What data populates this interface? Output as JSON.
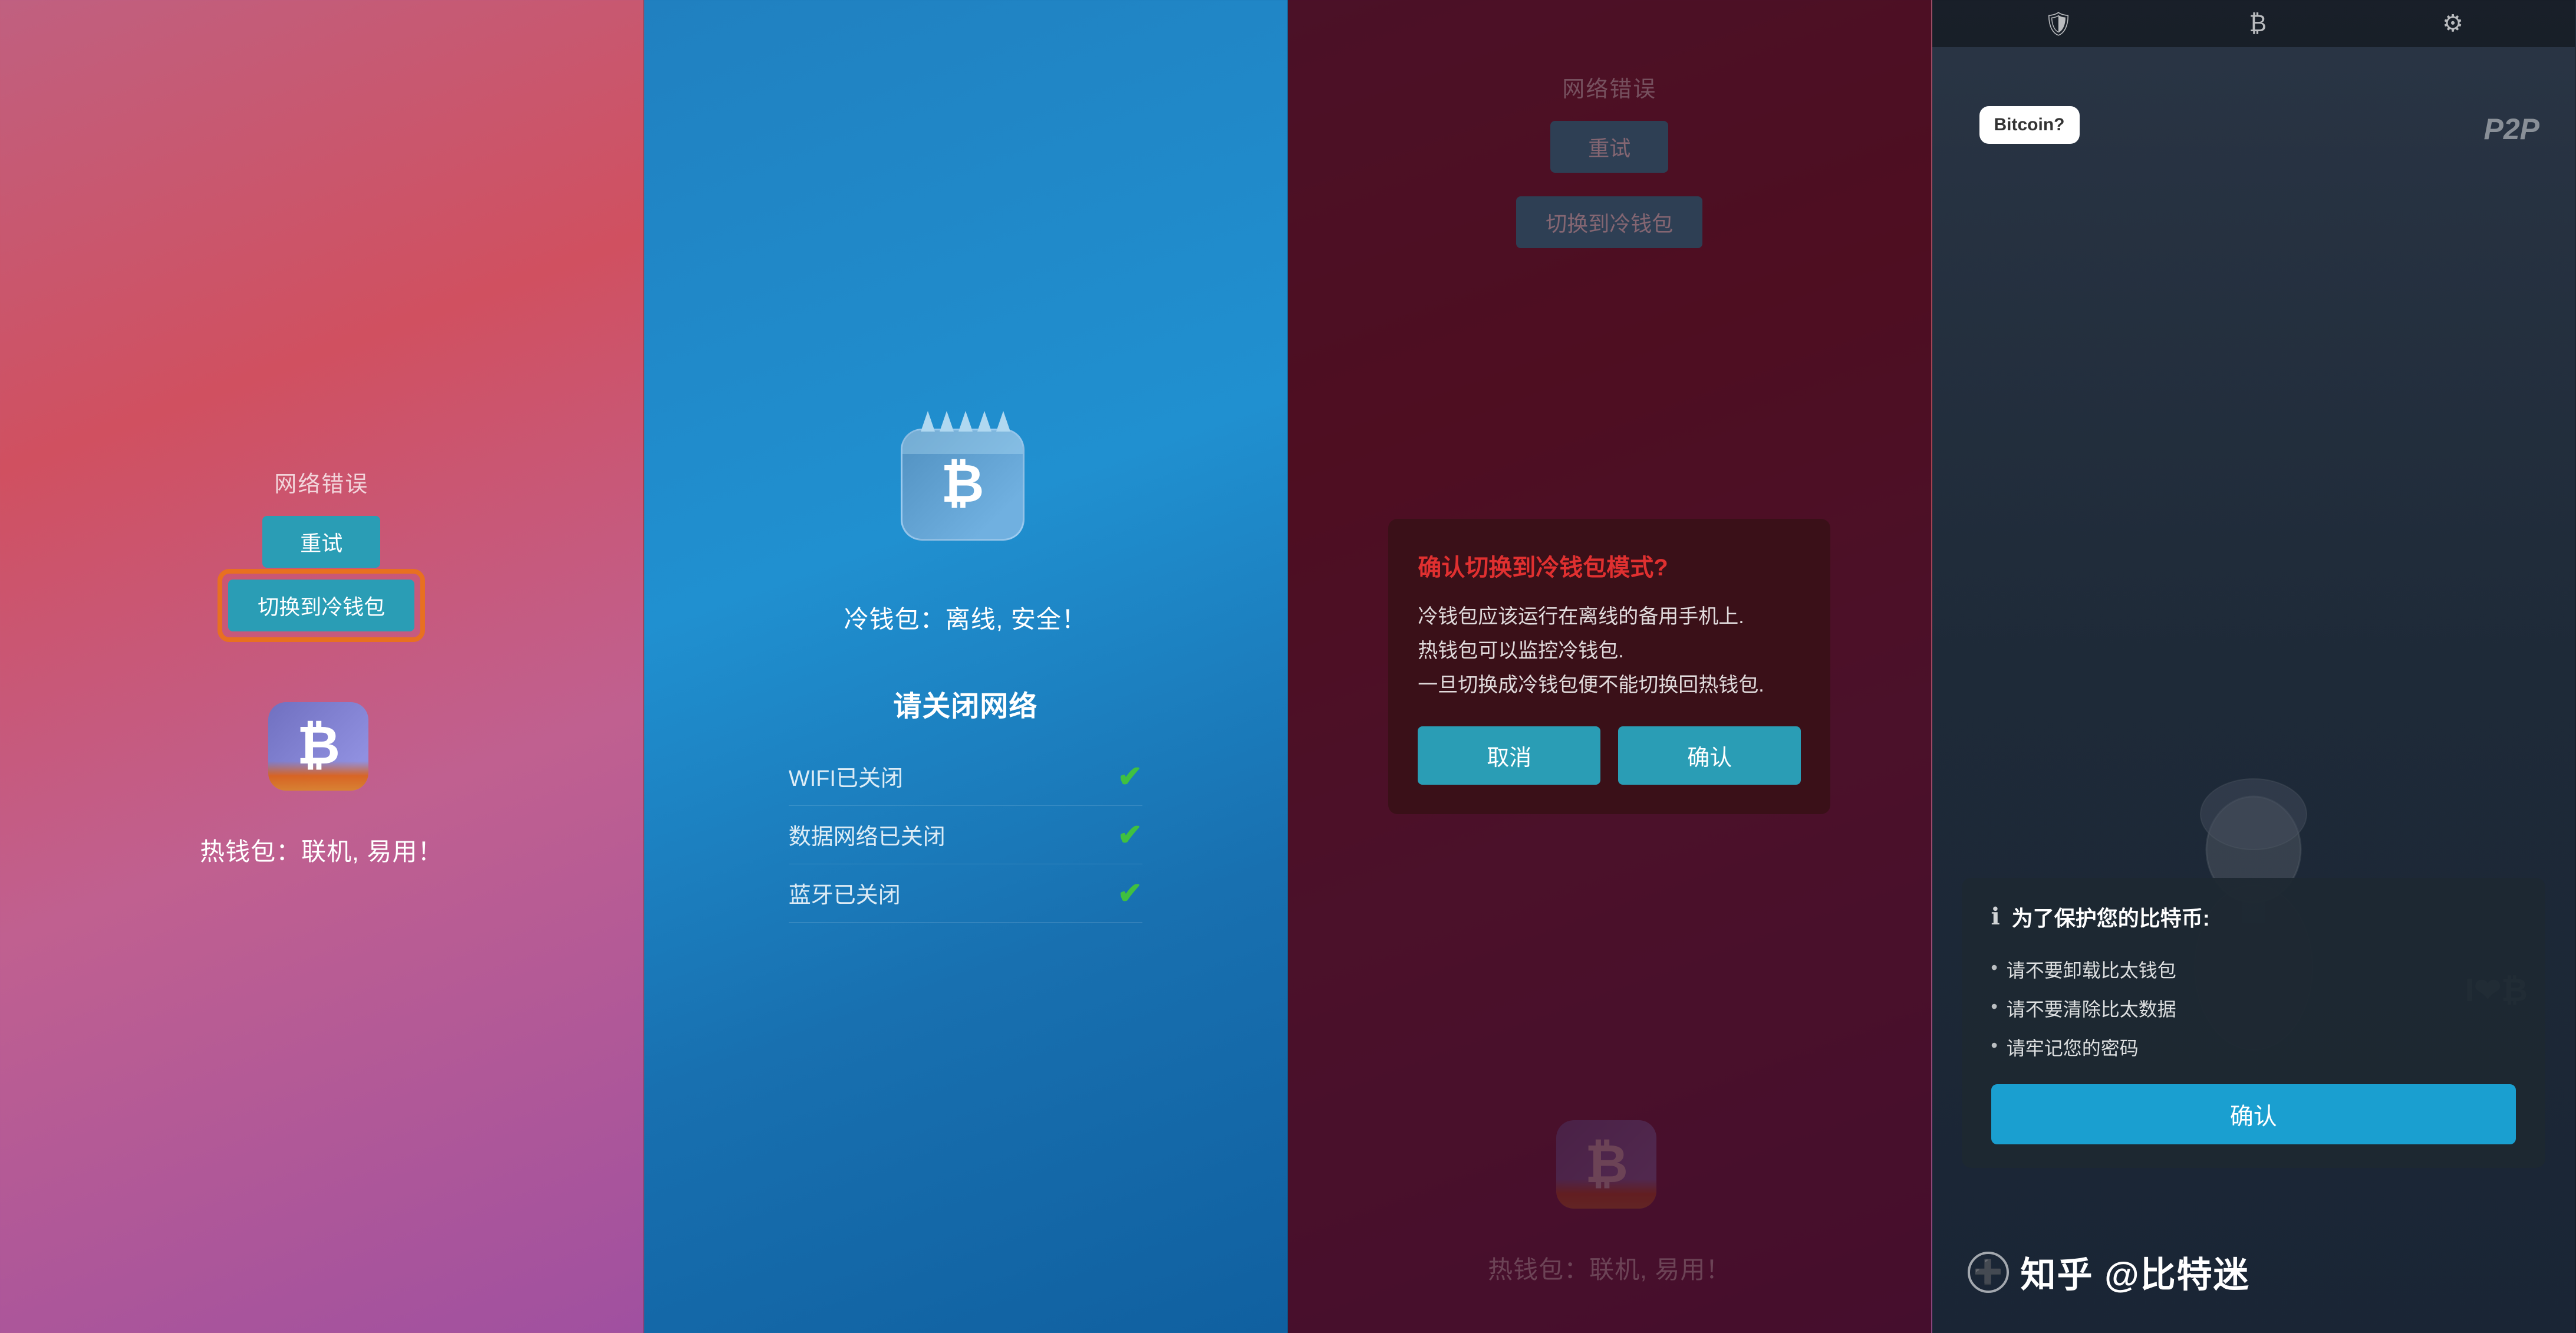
{
  "panels": {
    "panel1": {
      "error_label": "网络错误",
      "retry_button": "重试",
      "switch_cold_button": "切换到冷钱包",
      "hot_wallet_caption": "热钱包：联机, 易用！",
      "bitcoin_symbol": "₿"
    },
    "panel2": {
      "cold_wallet_caption": "冷钱包：离线, 安全！",
      "network_header": "请关闭网络",
      "network_items": [
        {
          "label": "WIFI已关闭",
          "checked": true
        },
        {
          "label": "数据网络已关闭",
          "checked": true
        },
        {
          "label": "蓝牙已关闭",
          "checked": true
        }
      ],
      "bitcoin_symbol": "₿"
    },
    "panel3": {
      "error_label": "网络错误",
      "retry_button": "重试",
      "switch_cold_button": "切换到冷钱包",
      "hot_wallet_caption": "热钱包：联机, 易用！",
      "bitcoin_symbol": "₿",
      "dialog": {
        "title": "确认切换到冷钱包模式?",
        "body_line1": "冷钱包应该运行在离线的备用手机上.",
        "body_line2": "热钱包可以监控冷钱包.",
        "body_line3": "一旦切换成冷钱包便不能切换回热钱包.",
        "cancel_button": "取消",
        "confirm_button": "确认"
      }
    },
    "panel4": {
      "topbar": {
        "shield_icon": "🛡",
        "bitcoin_icon": "₿",
        "gear_icon": "⚙"
      },
      "bubble_bitcoin": "Bitcoin?",
      "bubble_p2p": "P2P",
      "heart_text": "I❤₿",
      "protection_dialog": {
        "info_icon": "ℹ",
        "title": "为了保护您的比特币:",
        "items": [
          "请不要卸载比太钱包",
          "请不要清除比太数据",
          "请牢记您的密码"
        ],
        "confirm_button": "确认"
      },
      "watermark_icon": "➕",
      "watermark_text": "知乎 @比特迷"
    }
  }
}
